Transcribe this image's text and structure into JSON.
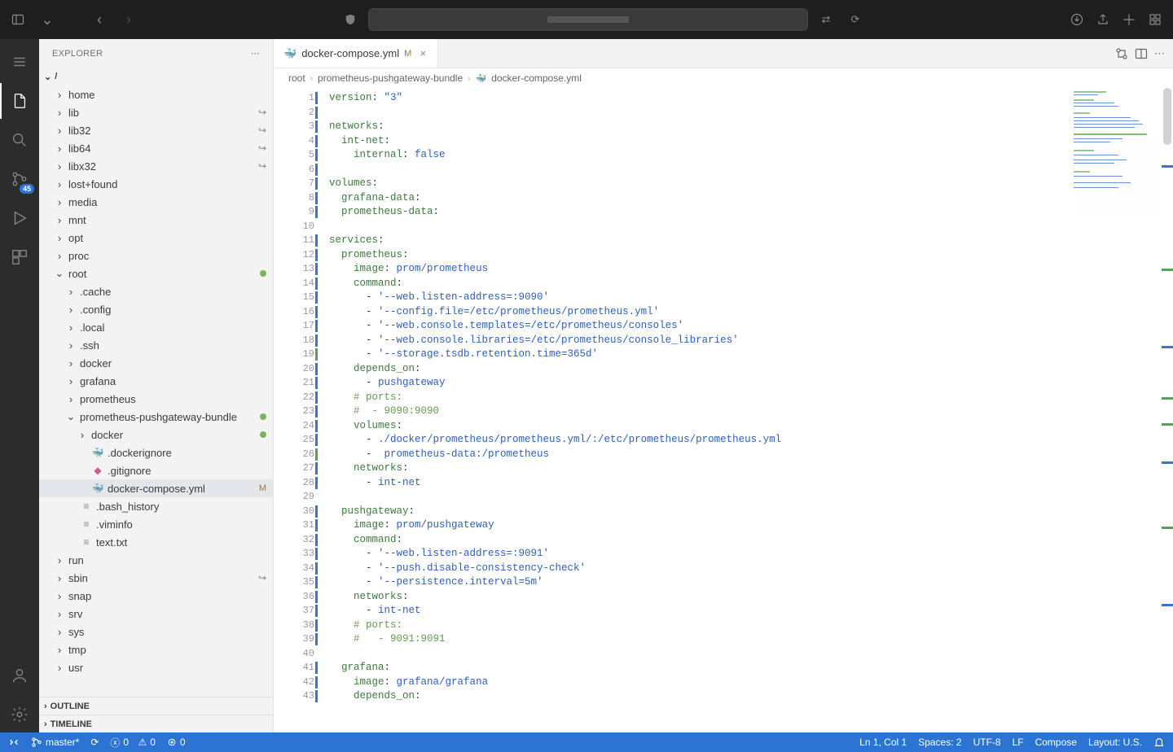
{
  "titlebar": {},
  "activity": {
    "scm_badge": "45"
  },
  "explorer": {
    "title": "EXPLORER",
    "root": "/",
    "tree": [
      {
        "l": "home",
        "d": 1,
        "t": "folder"
      },
      {
        "l": "lib",
        "d": 1,
        "t": "folder",
        "link": true
      },
      {
        "l": "lib32",
        "d": 1,
        "t": "folder",
        "link": true
      },
      {
        "l": "lib64",
        "d": 1,
        "t": "folder",
        "link": true
      },
      {
        "l": "libx32",
        "d": 1,
        "t": "folder",
        "link": true
      },
      {
        "l": "lost+found",
        "d": 1,
        "t": "folder"
      },
      {
        "l": "media",
        "d": 1,
        "t": "folder"
      },
      {
        "l": "mnt",
        "d": 1,
        "t": "folder"
      },
      {
        "l": "opt",
        "d": 1,
        "t": "folder"
      },
      {
        "l": "proc",
        "d": 1,
        "t": "folder"
      },
      {
        "l": "root",
        "d": 1,
        "t": "folder",
        "open": true,
        "dot": true
      },
      {
        "l": ".cache",
        "d": 2,
        "t": "folder"
      },
      {
        "l": ".config",
        "d": 2,
        "t": "folder"
      },
      {
        "l": ".local",
        "d": 2,
        "t": "folder"
      },
      {
        "l": ".ssh",
        "d": 2,
        "t": "folder"
      },
      {
        "l": "docker",
        "d": 2,
        "t": "folder"
      },
      {
        "l": "grafana",
        "d": 2,
        "t": "folder"
      },
      {
        "l": "prometheus",
        "d": 2,
        "t": "folder"
      },
      {
        "l": "prometheus-pushgateway-bundle",
        "d": 2,
        "t": "folder",
        "open": true,
        "dot": true
      },
      {
        "l": "docker",
        "d": 3,
        "t": "folder",
        "dot": true
      },
      {
        "l": ".dockerignore",
        "d": 3,
        "t": "file",
        "icon": "🐳"
      },
      {
        "l": ".gitignore",
        "d": 3,
        "t": "file",
        "icon": "◆"
      },
      {
        "l": "docker-compose.yml",
        "d": 3,
        "t": "file",
        "icon": "🐳",
        "deco": "M",
        "sel": true
      },
      {
        "l": ".bash_history",
        "d": 2,
        "t": "file"
      },
      {
        "l": ".viminfo",
        "d": 2,
        "t": "file"
      },
      {
        "l": "text.txt",
        "d": 2,
        "t": "file"
      },
      {
        "l": "run",
        "d": 1,
        "t": "folder"
      },
      {
        "l": "sbin",
        "d": 1,
        "t": "folder",
        "link": true
      },
      {
        "l": "snap",
        "d": 1,
        "t": "folder"
      },
      {
        "l": "srv",
        "d": 1,
        "t": "folder"
      },
      {
        "l": "sys",
        "d": 1,
        "t": "folder"
      },
      {
        "l": "tmp",
        "d": 1,
        "t": "folder"
      },
      {
        "l": "usr",
        "d": 1,
        "t": "folder"
      }
    ],
    "outline": "OUTLINE",
    "timeline": "TIMELINE"
  },
  "tabs": [
    {
      "label": "docker-compose.yml",
      "mod": "M",
      "icon": "🐳"
    }
  ],
  "breadcrumbs": [
    "root",
    "prometheus-pushgateway-bundle",
    "docker-compose.yml"
  ],
  "code": [
    {
      "n": 1,
      "m": "blue",
      "seg": [
        [
          "k",
          "version"
        ],
        [
          "",
          ": "
        ],
        [
          "s",
          "\"3\""
        ]
      ]
    },
    {
      "n": 2,
      "m": "blue",
      "seg": []
    },
    {
      "n": 3,
      "m": "blue",
      "seg": [
        [
          "k",
          "networks"
        ],
        [
          "",
          ":"
        ]
      ]
    },
    {
      "n": 4,
      "m": "blue",
      "seg": [
        [
          "",
          "  "
        ],
        [
          "k",
          "int-net"
        ],
        [
          "",
          ":"
        ]
      ]
    },
    {
      "n": 5,
      "m": "blue",
      "seg": [
        [
          "",
          "    "
        ],
        [
          "k",
          "internal"
        ],
        [
          "",
          ": "
        ],
        [
          "b",
          "false"
        ]
      ]
    },
    {
      "n": 6,
      "m": "blue",
      "seg": []
    },
    {
      "n": 7,
      "m": "blue",
      "seg": [
        [
          "k",
          "volumes"
        ],
        [
          "",
          ":"
        ]
      ]
    },
    {
      "n": 8,
      "m": "blue",
      "seg": [
        [
          "",
          "  "
        ],
        [
          "k",
          "grafana-data"
        ],
        [
          "",
          ":"
        ]
      ]
    },
    {
      "n": 9,
      "m": "blue",
      "seg": [
        [
          "",
          "  "
        ],
        [
          "k",
          "prometheus-data"
        ],
        [
          "",
          ":"
        ]
      ]
    },
    {
      "n": 10,
      "seg": []
    },
    {
      "n": 11,
      "m": "blue",
      "seg": [
        [
          "k",
          "services"
        ],
        [
          "",
          ":"
        ]
      ]
    },
    {
      "n": 12,
      "m": "blue",
      "seg": [
        [
          "",
          "  "
        ],
        [
          "k",
          "prometheus"
        ],
        [
          "",
          ":"
        ]
      ]
    },
    {
      "n": 13,
      "m": "blue",
      "seg": [
        [
          "",
          "    "
        ],
        [
          "k",
          "image"
        ],
        [
          "",
          ": "
        ],
        [
          "s",
          "prom/prometheus"
        ]
      ]
    },
    {
      "n": 14,
      "m": "blue",
      "seg": [
        [
          "",
          "    "
        ],
        [
          "k",
          "command"
        ],
        [
          "",
          ":"
        ]
      ]
    },
    {
      "n": 15,
      "m": "blue",
      "seg": [
        [
          "",
          "      - "
        ],
        [
          "s",
          "'--web.listen-address=:9090'"
        ]
      ]
    },
    {
      "n": 16,
      "m": "blue",
      "seg": [
        [
          "",
          "      - "
        ],
        [
          "s",
          "'--config.file=/etc/prometheus/prometheus.yml'"
        ]
      ]
    },
    {
      "n": 17,
      "m": "blue",
      "seg": [
        [
          "",
          "      - "
        ],
        [
          "s",
          "'--web.console.templates=/etc/prometheus/consoles'"
        ]
      ]
    },
    {
      "n": 18,
      "m": "blue",
      "seg": [
        [
          "",
          "      - "
        ],
        [
          "s",
          "'--web.console.libraries=/etc/prometheus/console_libraries'"
        ]
      ]
    },
    {
      "n": 19,
      "m": "mod",
      "seg": [
        [
          "",
          "      - "
        ],
        [
          "s",
          "'--storage.tsdb.retention.time=365d'"
        ]
      ]
    },
    {
      "n": 20,
      "m": "blue",
      "seg": [
        [
          "",
          "    "
        ],
        [
          "k",
          "depends_on"
        ],
        [
          "",
          ":"
        ]
      ]
    },
    {
      "n": 21,
      "m": "blue",
      "seg": [
        [
          "",
          "      - "
        ],
        [
          "s",
          "pushgateway"
        ]
      ]
    },
    {
      "n": 22,
      "m": "blue",
      "seg": [
        [
          "",
          "    "
        ],
        [
          "c",
          "# ports:"
        ]
      ]
    },
    {
      "n": 23,
      "m": "blue",
      "seg": [
        [
          "",
          "    "
        ],
        [
          "c",
          "#  - 9090:9090"
        ]
      ]
    },
    {
      "n": 24,
      "m": "blue",
      "seg": [
        [
          "",
          "    "
        ],
        [
          "k",
          "volumes"
        ],
        [
          "",
          ":"
        ]
      ]
    },
    {
      "n": 25,
      "m": "blue",
      "seg": [
        [
          "",
          "      - "
        ],
        [
          "s",
          "./docker/prometheus/prometheus.yml/:/etc/prometheus/prometheus.yml"
        ]
      ]
    },
    {
      "n": 26,
      "m": "mod",
      "seg": [
        [
          "",
          "      -  "
        ],
        [
          "s",
          "prometheus-data:/prometheus"
        ]
      ]
    },
    {
      "n": 27,
      "m": "blue",
      "seg": [
        [
          "",
          "    "
        ],
        [
          "k",
          "networks"
        ],
        [
          "",
          ":"
        ]
      ]
    },
    {
      "n": 28,
      "m": "blue",
      "seg": [
        [
          "",
          "      - "
        ],
        [
          "s",
          "int-net"
        ]
      ]
    },
    {
      "n": 29,
      "seg": []
    },
    {
      "n": 30,
      "m": "blue",
      "seg": [
        [
          "",
          "  "
        ],
        [
          "k",
          "pushgateway"
        ],
        [
          "",
          ":"
        ]
      ]
    },
    {
      "n": 31,
      "m": "blue",
      "seg": [
        [
          "",
          "    "
        ],
        [
          "k",
          "image"
        ],
        [
          "",
          ": "
        ],
        [
          "s",
          "prom/pushgateway"
        ]
      ]
    },
    {
      "n": 32,
      "m": "blue",
      "seg": [
        [
          "",
          "    "
        ],
        [
          "k",
          "command"
        ],
        [
          "",
          ":"
        ]
      ]
    },
    {
      "n": 33,
      "m": "blue",
      "seg": [
        [
          "",
          "      - "
        ],
        [
          "s",
          "'--web.listen-address=:9091'"
        ]
      ]
    },
    {
      "n": 34,
      "m": "blue",
      "seg": [
        [
          "",
          "      - "
        ],
        [
          "s",
          "'--push.disable-consistency-check'"
        ]
      ]
    },
    {
      "n": 35,
      "m": "blue",
      "seg": [
        [
          "",
          "      - "
        ],
        [
          "s",
          "'--persistence.interval=5m'"
        ]
      ]
    },
    {
      "n": 36,
      "m": "blue",
      "seg": [
        [
          "",
          "    "
        ],
        [
          "k",
          "networks"
        ],
        [
          "",
          ":"
        ]
      ]
    },
    {
      "n": 37,
      "m": "blue",
      "seg": [
        [
          "",
          "      - "
        ],
        [
          "s",
          "int-net"
        ]
      ]
    },
    {
      "n": 38,
      "m": "blue",
      "seg": [
        [
          "",
          "    "
        ],
        [
          "c",
          "# ports:"
        ]
      ]
    },
    {
      "n": 39,
      "m": "blue",
      "seg": [
        [
          "",
          "    "
        ],
        [
          "c",
          "#   - 9091:9091"
        ]
      ]
    },
    {
      "n": 40,
      "seg": []
    },
    {
      "n": 41,
      "m": "blue",
      "seg": [
        [
          "",
          "  "
        ],
        [
          "k",
          "grafana"
        ],
        [
          "",
          ":"
        ]
      ]
    },
    {
      "n": 42,
      "m": "blue",
      "seg": [
        [
          "",
          "    "
        ],
        [
          "k",
          "image"
        ],
        [
          "",
          ": "
        ],
        [
          "s",
          "grafana/grafana"
        ]
      ]
    },
    {
      "n": 43,
      "m": "blue",
      "seg": [
        [
          "",
          "    "
        ],
        [
          "k",
          "depends_on"
        ],
        [
          "",
          ":"
        ]
      ]
    }
  ],
  "status": {
    "branch": "master*",
    "errors": "0",
    "warnings": "0",
    "ports_label": "0",
    "ln": "Ln 1, Col 1",
    "spaces": "Spaces: 2",
    "enc": "UTF-8",
    "eol": "LF",
    "lang": "Compose",
    "layout": "Layout: U.S."
  }
}
